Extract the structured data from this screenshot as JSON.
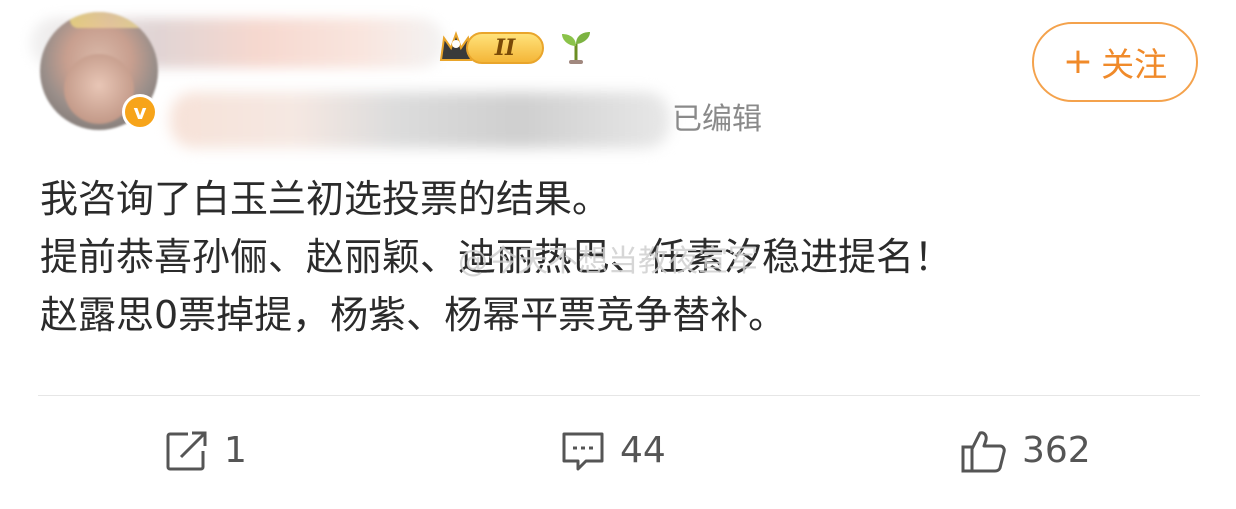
{
  "post": {
    "edited_label": "已编辑",
    "follow_label": "关注",
    "follow_plus": "+",
    "verified_mark": "v",
    "level_label": "II",
    "content_lines": [
      "我咨询了白玉兰初选投票的结果。",
      "提前恭喜孙俪、赵丽颖、迪丽热巴、任素汐稳进提名！",
      "赵露思0票掉提，杨紫、杨幂平票竞争替补。"
    ],
    "watermark": "@今天不想当教夜宣军"
  },
  "actions": {
    "repost_count": "1",
    "comment_count": "44",
    "like_count": "362"
  },
  "icons": {
    "repost": "share-square-arrow-icon",
    "comment": "comment-bubble-icon",
    "like": "thumbs-up-icon",
    "crown": "crown-icon",
    "sprout": "sprout-icon"
  },
  "colors": {
    "accent": "#f08a2a",
    "verified": "#f7a41a",
    "muted_text": "#8a8a8a"
  }
}
